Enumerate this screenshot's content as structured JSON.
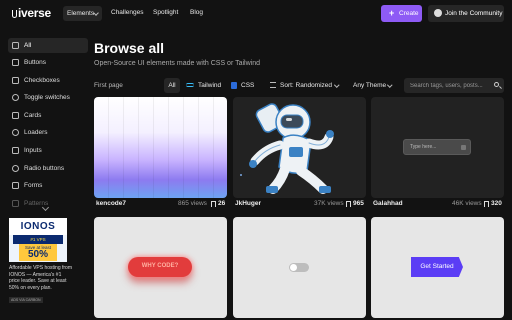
{
  "header": {
    "logo": "iverse",
    "nav": [
      "Elements",
      "Challenges",
      "Spotlight",
      "Blog"
    ],
    "create_label": "Create",
    "community_label": "Join the Community"
  },
  "sidebar": {
    "items": [
      {
        "label": "All",
        "icon": "grid-icon"
      },
      {
        "label": "Buttons",
        "icon": "button-icon"
      },
      {
        "label": "Checkboxes",
        "icon": "checkbox-icon"
      },
      {
        "label": "Toggle switches",
        "icon": "toggle-icon"
      },
      {
        "label": "Cards",
        "icon": "card-icon"
      },
      {
        "label": "Loaders",
        "icon": "loader-icon"
      },
      {
        "label": "Inputs",
        "icon": "input-icon"
      },
      {
        "label": "Radio buttons",
        "icon": "radio-icon"
      },
      {
        "label": "Forms",
        "icon": "form-icon"
      },
      {
        "label": "Patterns",
        "icon": "pattern-icon"
      }
    ]
  },
  "ad": {
    "brand": "IONOS",
    "subtitle": "#1 VPS",
    "save_line1": "Save at least",
    "save_value": "50%",
    "text": "Affordable VPS hosting from IONOS — America's #1 price leader. Save at least 50% on every plan.",
    "cta": "ADS VIA CARBON"
  },
  "main": {
    "title": "Browse all",
    "subtitle": "Open-Source UI elements made with CSS or Tailwind",
    "page_label": "First page"
  },
  "filters": {
    "all": "All",
    "tailwind": "Tailwind",
    "css": "CSS",
    "sort": "Sort: Randomized",
    "theme": "Any Theme",
    "search_placeholder": "Search tags, users, posts..."
  },
  "cards": [
    {
      "author": "kencode7",
      "views": "865 views",
      "saves": "26"
    },
    {
      "author": "JkHuger",
      "views": "37K views",
      "saves": "965"
    },
    {
      "author": "Galahhad",
      "views": "46K views",
      "saves": "320"
    }
  ],
  "previews": {
    "input_placeholder": "Type here...",
    "fire_button": "WHY CODE?",
    "get_started": "Get Started"
  },
  "colors": {
    "accent": "#8e5bf5",
    "background": "#121212"
  }
}
